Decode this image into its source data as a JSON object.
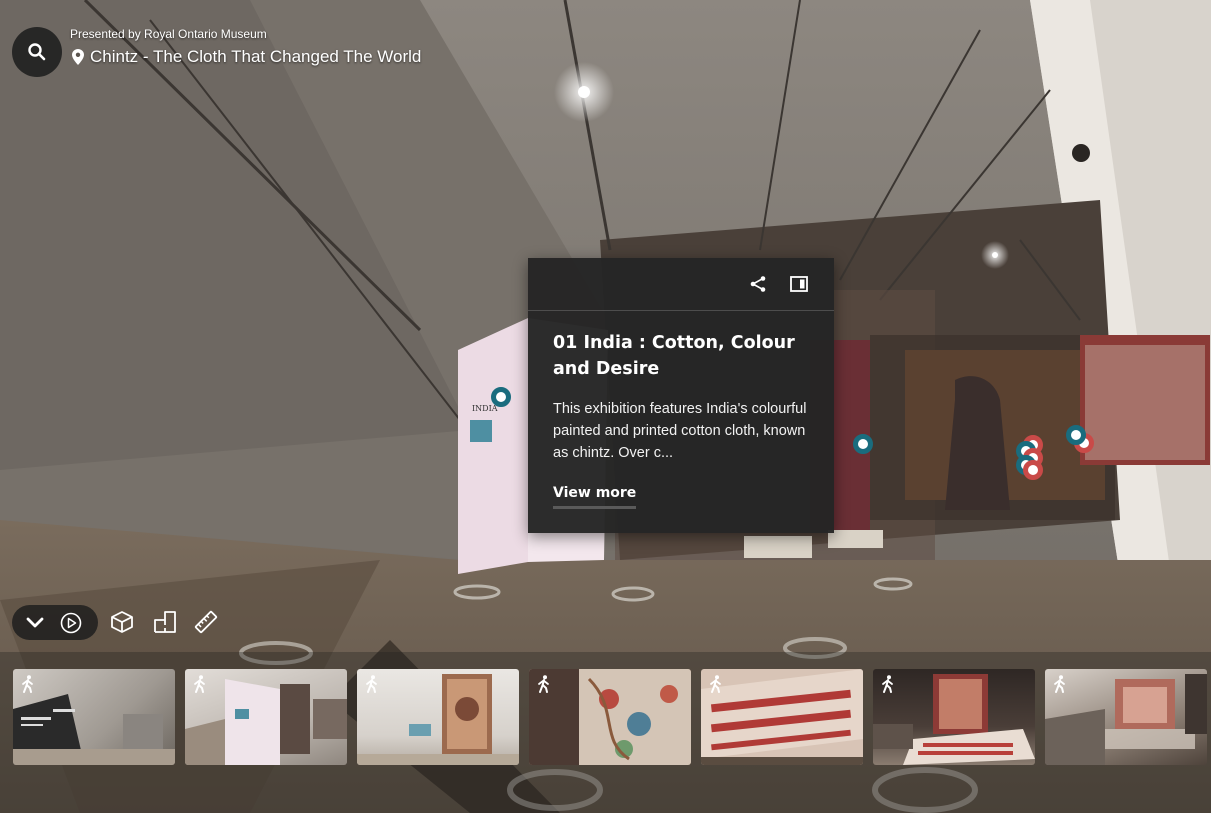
{
  "header": {
    "presented_by": "Presented by Royal Ontario Museum",
    "space_title": "Chintz - The Cloth That Changed The World"
  },
  "wall_sign": {
    "title": "INDIA"
  },
  "tag_card": {
    "title": "01 India : Cotton, Colour and Desire",
    "description": "This exhibition features India's colourful painted and printed cotton cloth, known as chintz. Over c...",
    "view_more_label": "View more"
  },
  "colors": {
    "tag_teal": "#1a6c7e",
    "tag_red": "#c94a48",
    "card_bg": "#252525"
  },
  "icons": {
    "search": "search-icon",
    "location": "map-pin-icon",
    "share": "share-icon",
    "side_panel": "side-panel-icon",
    "collapse": "chevron-down-icon",
    "play": "play-circle-icon",
    "dollhouse": "dollhouse-icon",
    "floorplan": "floorplan-icon",
    "measure": "ruler-icon",
    "walk": "walking-person-icon"
  },
  "thumbnails": [
    {
      "icon": "walking-person-icon"
    },
    {
      "icon": "walking-person-icon"
    },
    {
      "icon": "walking-person-icon"
    },
    {
      "icon": "walking-person-icon"
    },
    {
      "icon": "walking-person-icon"
    },
    {
      "icon": "walking-person-icon"
    },
    {
      "icon": "walking-person-icon"
    }
  ]
}
